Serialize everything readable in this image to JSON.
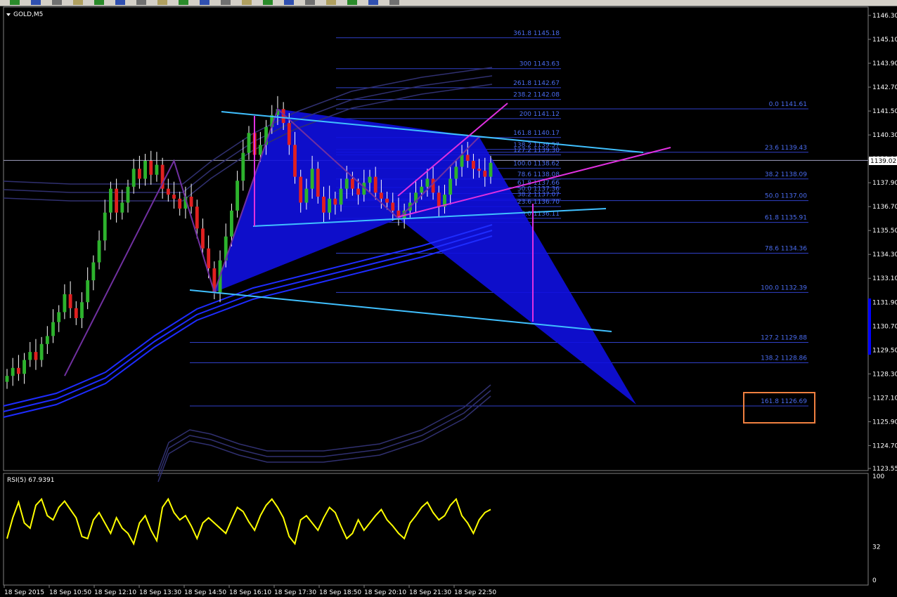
{
  "toolbar": {
    "buttons": [
      "arrow-icon",
      "zoom-icon",
      "crosshair-icon",
      "bars-icon",
      "candles-icon",
      "line-chart-icon",
      "zoom-in-icon",
      "zoom-out-icon",
      "grid-icon",
      "autoscroll-icon",
      "indicators-icon",
      "period-icon",
      "templates-icon",
      "new-order-icon",
      "expert-icon",
      "history-icon",
      "fib-icon",
      "text-icon",
      "arrow-draw-icon"
    ]
  },
  "chart_data": {
    "type": "candlestick",
    "symbol_label": "GOLD,M5",
    "current_price_label": "1139.02",
    "y_axis_ticks": [
      "1146.30",
      "1145.10",
      "1143.90",
      "1142.70",
      "1141.50",
      "1140.30",
      "1139.10",
      "1137.90",
      "1136.70",
      "1135.50",
      "1134.30",
      "1133.10",
      "1131.90",
      "1130.70",
      "1129.50",
      "1128.30",
      "1127.10",
      "1125.90",
      "1124.70",
      "1123.55"
    ],
    "x_axis_ticks": [
      "18 Sep 2015",
      "18 Sep 10:50",
      "18 Sep 12:10",
      "18 Sep 13:30",
      "18 Sep 14:50",
      "18 Sep 16:10",
      "18 Sep 17:30",
      "18 Sep 18:50",
      "18 Sep 20:10",
      "18 Sep 21:30",
      "18 Sep 22:50"
    ],
    "fib_right": [
      {
        "level": "0.0",
        "price": "1141.61"
      },
      {
        "level": "23.6",
        "price": "1139.43"
      },
      {
        "level": "38.2",
        "price": "1138.09"
      },
      {
        "level": "50.0",
        "price": "1137.00"
      },
      {
        "level": "61.8",
        "price": "1135.91"
      },
      {
        "level": "78.6",
        "price": "1134.36"
      },
      {
        "level": "100.0",
        "price": "1132.39"
      },
      {
        "level": "127.2",
        "price": "1129.88"
      },
      {
        "level": "138.2",
        "price": "1128.86"
      },
      {
        "level": "161.8",
        "price": "1126.69"
      }
    ],
    "fib_mid": [
      {
        "level": "361.8",
        "price": "1145.18"
      },
      {
        "level": "300",
        "price": "1143.63"
      },
      {
        "level": "261.8",
        "price": "1142.67"
      },
      {
        "level": "238.2",
        "price": "1142.08"
      },
      {
        "level": "200",
        "price": "1141.12"
      },
      {
        "level": "161.8",
        "price": "1140.17"
      },
      {
        "level": "138.2",
        "price": "1139.57"
      },
      {
        "level": "127.2",
        "price": "1139.30"
      },
      {
        "level": "100.0",
        "price": "1138.62"
      },
      {
        "level": "78.6",
        "price": "1138.08"
      },
      {
        "level": "61.8",
        "price": "1137.66"
      },
      {
        "level": "50.0",
        "price": "1137.36"
      },
      {
        "level": "38.2",
        "price": "1137.07"
      },
      {
        "level": "23.6",
        "price": "1136.70"
      },
      {
        "level": "0.0",
        "price": "1136.11"
      }
    ],
    "closes": [
      1128.2,
      1128.6,
      1128.3,
      1129.0,
      1129.4,
      1129.0,
      1129.8,
      1130.2,
      1130.9,
      1131.4,
      1132.3,
      1131.6,
      1131.1,
      1131.9,
      1133.0,
      1133.9,
      1135.0,
      1136.4,
      1137.6,
      1136.4,
      1136.9,
      1137.7,
      1138.6,
      1138.1,
      1139.0,
      1138.3,
      1138.8,
      1137.6,
      1137.3,
      1137.1,
      1136.6,
      1137.2,
      1136.7,
      1135.6,
      1134.6,
      1133.6,
      1132.4,
      1134.0,
      1135.2,
      1136.5,
      1138.0,
      1139.4,
      1140.4,
      1139.3,
      1139.8,
      1140.7,
      1141.3,
      1141.6,
      1140.9,
      1139.8,
      1138.2,
      1136.9,
      1137.6,
      1138.6,
      1137.2,
      1136.4,
      1137.1,
      1136.8,
      1137.6,
      1138.1,
      1137.6,
      1137.3,
      1137.9,
      1138.2,
      1137.4,
      1137.1,
      1136.9,
      1136.5,
      1136.1,
      1136.5,
      1136.9,
      1137.4,
      1137.7,
      1138.1,
      1137.4,
      1136.7,
      1137.3,
      1138.1,
      1138.7,
      1139.3,
      1139.0,
      1138.6,
      1138.5,
      1138.2,
      1138.9
    ],
    "rsi_label": "RSI(5) 67.9391",
    "rsi_axis_ticks": [
      "100",
      "32",
      "0"
    ],
    "rsi_values": [
      40,
      60,
      75,
      55,
      50,
      72,
      78,
      62,
      58,
      70,
      76,
      68,
      60,
      42,
      40,
      58,
      65,
      55,
      45,
      60,
      50,
      45,
      35,
      55,
      62,
      48,
      38,
      70,
      78,
      65,
      58,
      62,
      52,
      40,
      55,
      60,
      55,
      50,
      45,
      58,
      70,
      66,
      56,
      48,
      62,
      72,
      78,
      70,
      60,
      42,
      35,
      58,
      62,
      55,
      48,
      60,
      70,
      65,
      52,
      40,
      45,
      58,
      48,
      55,
      62,
      68,
      58,
      52,
      45,
      40,
      55,
      62,
      70,
      75,
      65,
      58,
      62,
      72,
      78,
      62,
      55,
      45,
      58,
      65,
      68
    ]
  }
}
